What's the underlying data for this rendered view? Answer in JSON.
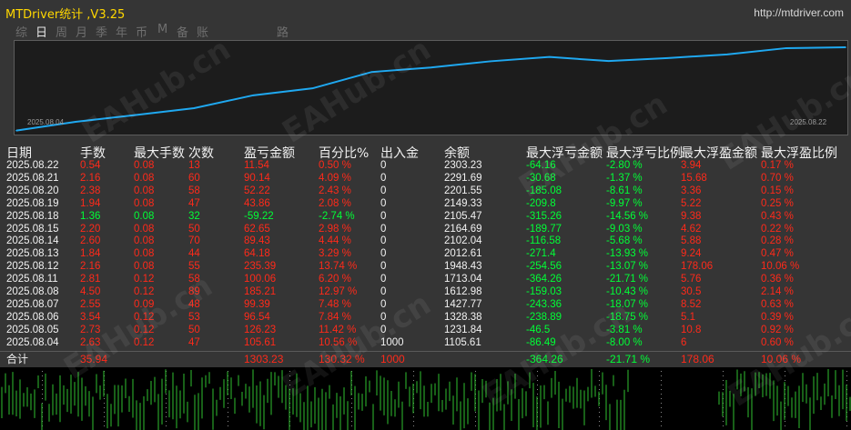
{
  "app": {
    "title": "MTDriver统计  ,V3.25",
    "url": "http://mtdriver.com"
  },
  "tabs": [
    {
      "label": "综",
      "active": false
    },
    {
      "label": "日",
      "active": true
    },
    {
      "label": "周",
      "active": false
    },
    {
      "label": "月",
      "active": false
    },
    {
      "label": "季",
      "active": false
    },
    {
      "label": "年",
      "active": false
    },
    {
      "label": "币",
      "active": false
    },
    {
      "label": "M",
      "active": false
    },
    {
      "label": "备",
      "active": false
    },
    {
      "label": "账户",
      "active": false
    },
    {
      "label": "路径",
      "active": false
    }
  ],
  "equity_chart": {
    "start_label": "2025.08.04",
    "end_label": "2025.08.22",
    "line_color": "#1fa8f0",
    "chart_data": {
      "type": "line",
      "x": [
        "2025.08.04",
        "2025.08.05",
        "2025.08.06",
        "2025.08.07",
        "2025.08.08",
        "2025.08.11",
        "2025.08.12",
        "2025.08.13",
        "2025.08.14",
        "2025.08.15",
        "2025.08.18",
        "2025.08.19",
        "2025.08.20",
        "2025.08.21",
        "2025.08.22"
      ],
      "values": [
        1105.61,
        1231.84,
        1328.38,
        1427.77,
        1612.98,
        1713.04,
        1948.43,
        2012.61,
        2102.04,
        2164.69,
        2105.47,
        2149.33,
        2201.55,
        2291.69,
        2303.23
      ]
    }
  },
  "table": {
    "headers": {
      "date": "日期",
      "lots": "手数",
      "max_lots": "最大手数",
      "count": "次数",
      "pnl": "盈亏金额",
      "pct": "百分比%",
      "io": "出入金",
      "balance": "余额",
      "max_float_loss": "最大浮亏金额",
      "max_float_loss_ratio": "最大浮亏比例",
      "max_float_profit": "最大浮盈金额",
      "max_float_profit_ratio": "最大浮盈比例"
    },
    "rows": [
      {
        "date": "2025.08.22",
        "lots": "0.54",
        "max_lots": "0.08",
        "count": "13",
        "pnl": "11.54",
        "pct": "0.50 %",
        "io": "0",
        "balance": "2303.23",
        "mfl": "-64.16",
        "mflr": "-2.80 %",
        "mfp": "3.94",
        "mfpr": "0.17 %",
        "sign": "pos"
      },
      {
        "date": "2025.08.21",
        "lots": "2.16",
        "max_lots": "0.08",
        "count": "60",
        "pnl": "90.14",
        "pct": "4.09 %",
        "io": "0",
        "balance": "2291.69",
        "mfl": "-30.68",
        "mflr": "-1.37 %",
        "mfp": "15.68",
        "mfpr": "0.70 %",
        "sign": "pos"
      },
      {
        "date": "2025.08.20",
        "lots": "2.38",
        "max_lots": "0.08",
        "count": "58",
        "pnl": "52.22",
        "pct": "2.43 %",
        "io": "0",
        "balance": "2201.55",
        "mfl": "-185.08",
        "mflr": "-8.61 %",
        "mfp": "3.36",
        "mfpr": "0.15 %",
        "sign": "pos"
      },
      {
        "date": "2025.08.19",
        "lots": "1.94",
        "max_lots": "0.08",
        "count": "47",
        "pnl": "43.86",
        "pct": "2.08 %",
        "io": "0",
        "balance": "2149.33",
        "mfl": "-209.8",
        "mflr": "-9.97 %",
        "mfp": "5.22",
        "mfpr": "0.25 %",
        "sign": "pos"
      },
      {
        "date": "2025.08.18",
        "lots": "1.36",
        "max_lots": "0.08",
        "count": "32",
        "pnl": "-59.22",
        "pct": "-2.74 %",
        "io": "0",
        "balance": "2105.47",
        "mfl": "-315.26",
        "mflr": "-14.56 %",
        "mfp": "9.38",
        "mfpr": "0.43 %",
        "sign": "neg"
      },
      {
        "date": "2025.08.15",
        "lots": "2.20",
        "max_lots": "0.08",
        "count": "50",
        "pnl": "62.65",
        "pct": "2.98 %",
        "io": "0",
        "balance": "2164.69",
        "mfl": "-189.77",
        "mflr": "-9.03 %",
        "mfp": "4.62",
        "mfpr": "0.22 %",
        "sign": "pos"
      },
      {
        "date": "2025.08.14",
        "lots": "2.60",
        "max_lots": "0.08",
        "count": "70",
        "pnl": "89.43",
        "pct": "4.44 %",
        "io": "0",
        "balance": "2102.04",
        "mfl": "-116.58",
        "mflr": "-5.68 %",
        "mfp": "5.88",
        "mfpr": "0.28 %",
        "sign": "pos"
      },
      {
        "date": "2025.08.13",
        "lots": "1.84",
        "max_lots": "0.08",
        "count": "44",
        "pnl": "64.18",
        "pct": "3.29 %",
        "io": "0",
        "balance": "2012.61",
        "mfl": "-271.4",
        "mflr": "-13.93 %",
        "mfp": "9.24",
        "mfpr": "0.47 %",
        "sign": "pos"
      },
      {
        "date": "2025.08.12",
        "lots": "2.16",
        "max_lots": "0.08",
        "count": "55",
        "pnl": "235.39",
        "pct": "13.74 %",
        "io": "0",
        "balance": "1948.43",
        "mfl": "-254.56",
        "mflr": "-13.07 %",
        "mfp": "178.06",
        "mfpr": "10.06 %",
        "sign": "pos"
      },
      {
        "date": "2025.08.11",
        "lots": "2.81",
        "max_lots": "0.12",
        "count": "58",
        "pnl": "100.06",
        "pct": "6.20 %",
        "io": "0",
        "balance": "1713.04",
        "mfl": "-364.26",
        "mflr": "-21.71 %",
        "mfp": "5.76",
        "mfpr": "0.36 %",
        "sign": "pos"
      },
      {
        "date": "2025.08.08",
        "lots": "4.50",
        "max_lots": "0.12",
        "count": "89",
        "pnl": "185.21",
        "pct": "12.97 %",
        "io": "0",
        "balance": "1612.98",
        "mfl": "-159.03",
        "mflr": "-10.43 %",
        "mfp": "30.5",
        "mfpr": "2.14 %",
        "sign": "pos"
      },
      {
        "date": "2025.08.07",
        "lots": "2.55",
        "max_lots": "0.09",
        "count": "48",
        "pnl": "99.39",
        "pct": "7.48 %",
        "io": "0",
        "balance": "1427.77",
        "mfl": "-243.36",
        "mflr": "-18.07 %",
        "mfp": "8.52",
        "mfpr": "0.63 %",
        "sign": "pos"
      },
      {
        "date": "2025.08.06",
        "lots": "3.54",
        "max_lots": "0.12",
        "count": "53",
        "pnl": "96.54",
        "pct": "7.84 %",
        "io": "0",
        "balance": "1328.38",
        "mfl": "-238.89",
        "mflr": "-18.75 %",
        "mfp": "5.1",
        "mfpr": "0.39 %",
        "sign": "pos"
      },
      {
        "date": "2025.08.05",
        "lots": "2.73",
        "max_lots": "0.12",
        "count": "50",
        "pnl": "126.23",
        "pct": "11.42 %",
        "io": "0",
        "balance": "1231.84",
        "mfl": "-46.5",
        "mflr": "-3.81 %",
        "mfp": "10.8",
        "mfpr": "0.92 %",
        "sign": "pos"
      },
      {
        "date": "2025.08.04",
        "lots": "2.63",
        "max_lots": "0.12",
        "count": "47",
        "pnl": "105.61",
        "pct": "10.56 %",
        "io": "1000",
        "balance": "1105.61",
        "mfl": "-86.49",
        "mflr": "-8.00 %",
        "mfp": "6",
        "mfpr": "0.60 %",
        "sign": "pos"
      }
    ],
    "total": {
      "label": "合计",
      "lots": "35.94",
      "pnl": "1303.23",
      "pct": "130.32 %",
      "io": "1000",
      "mfl": "-364.26",
      "mflr": "-21.71 %",
      "mfp": "178.06",
      "mfpr": "10.06 %"
    }
  },
  "colors": {
    "panel_bg": "#353535",
    "title": "#ffd700",
    "positive": "#ff2a1a",
    "negative": "#00ff36",
    "neutral": "#f2f2f2",
    "candles": "#2fbf2f"
  },
  "watermark": "EAHub.cn"
}
